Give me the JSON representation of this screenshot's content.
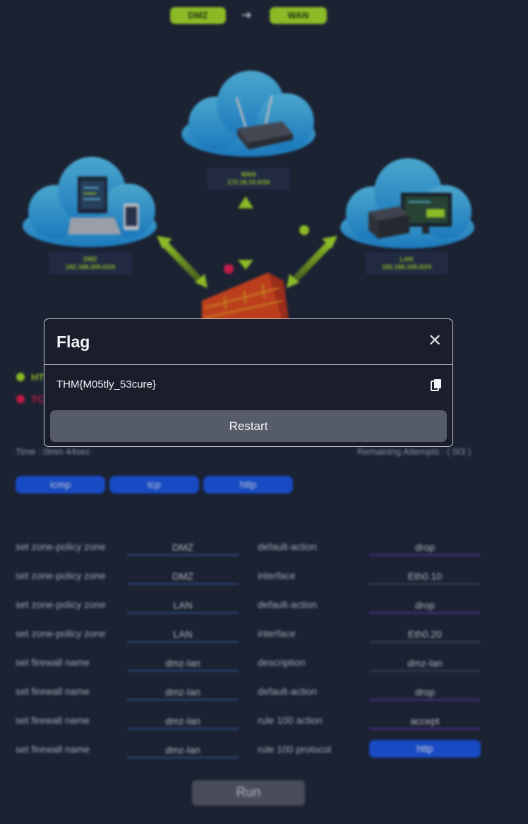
{
  "header": {
    "from": "DMZ",
    "to": "WAN",
    "arrow": "➜"
  },
  "zones": {
    "wan": {
      "name": "WAN",
      "subnet": "172.16.10.0/24"
    },
    "dmz": {
      "name": "DMZ",
      "subnet": "192.168.200.0/24"
    },
    "lan": {
      "name": "LAN",
      "subnet": "192.168.100.0/24"
    }
  },
  "screen_text": "Flag",
  "legend": [
    {
      "label": "HTTP",
      "color": "#a8e02a"
    },
    {
      "label": "TCP",
      "color": "#e81e50"
    }
  ],
  "status": {
    "time": "Time : 0min 44sec",
    "attempts": "Remaining Attempts : ( 0/3 )"
  },
  "protocols": [
    "icmp",
    "tcp",
    "http"
  ],
  "rules": [
    {
      "command": "set zone-policy zone",
      "name": "DMZ",
      "param": "default-action",
      "value": "drop"
    },
    {
      "command": "set zone-policy zone",
      "name": "DMZ",
      "param": "interface",
      "value": "Eth0.10"
    },
    {
      "command": "set zone-policy zone",
      "name": "LAN",
      "param": "default-action",
      "value": "drop"
    },
    {
      "command": "set zone-policy zone",
      "name": "LAN",
      "param": "interface",
      "value": "Eth0.20"
    },
    {
      "command": "set firewall name",
      "name": "dmz-lan",
      "param": "description",
      "value": "dmz-lan"
    },
    {
      "command": "set firewall name",
      "name": "dmz-lan",
      "param": "default-action",
      "value": "drop"
    },
    {
      "command": "set firewall name",
      "name": "dmz-lan",
      "param": "rule 100 action",
      "value": "accept"
    },
    {
      "command": "set firewall name",
      "name": "dmz-lan",
      "param": "rule 100 protocol",
      "value": "http"
    }
  ],
  "run_label": "Run",
  "modal": {
    "title": "Flag",
    "close_icon": "close-icon",
    "flag": "THM{M05tly_53cure}",
    "copy_icon": "copy-icon",
    "restart_label": "Restart"
  },
  "colors": {
    "accent_green": "#a8e02a",
    "accent_red": "#e81e50",
    "button_blue": "#1a57e8"
  }
}
